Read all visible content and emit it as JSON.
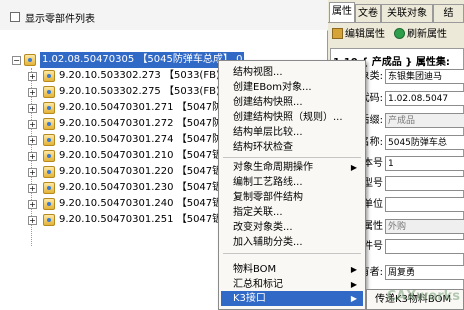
{
  "left_panel": {
    "show_parts_label": "显示零部件列表",
    "tree": [
      {
        "code": "1.02.08.50470305",
        "name": "【5045防弹车总成】",
        "qty": "0",
        "selected": true
      },
      {
        "code": "9.20.10.503302.273",
        "name": "【5033(FB)防"
      },
      {
        "code": "9.20.10.503302.275",
        "name": "【5033(FB)防"
      },
      {
        "code": "9.20.10.50470301.271",
        "name": "【5047防弹"
      },
      {
        "code": "9.20.10.50470301.272",
        "name": "【5047防弹"
      },
      {
        "code": "9.20.10.50470301.274",
        "name": "【5047防弹"
      },
      {
        "code": "9.20.10.50470301.210",
        "name": "【5047钣金"
      },
      {
        "code": "9.20.10.50470301.220",
        "name": "【5047钣金"
      },
      {
        "code": "9.20.10.50470301.230",
        "name": "【5047钣金"
      },
      {
        "code": "9.20.10.50470301.240",
        "name": "【5047钣金"
      },
      {
        "code": "9.20.10.50470301.251",
        "name": "【5047钣金"
      }
    ]
  },
  "context_menu": {
    "items": [
      {
        "label": "结构视图..."
      },
      {
        "label": "创建EBom对象..."
      },
      {
        "label": "创建结构快照..."
      },
      {
        "label": "创建结构快照（规则）..."
      },
      {
        "label": "结构单层比较..."
      },
      {
        "label": "结构环状检查"
      },
      {
        "label": "对象生命周期操作",
        "submenu": true
      },
      {
        "label": "编制工艺路线..."
      },
      {
        "label": "复制零部件结构"
      },
      {
        "label": "指定关联..."
      },
      {
        "label": "改变对象类..."
      },
      {
        "label": "加入辅助分类..."
      },
      {
        "label": "物料BOM",
        "submenu": true
      },
      {
        "label": "汇总和标记",
        "submenu": true
      },
      {
        "label": "K3接口",
        "submenu": true,
        "highlighted": true
      }
    ],
    "submenu_item": "传递K3物料BOM"
  },
  "right_panel": {
    "tabs": [
      "属性",
      "文卷",
      "关联对象",
      "结"
    ],
    "toolbar": {
      "edit": "编辑属性",
      "refresh": "刷新属性"
    },
    "section_title": "1.10 { 产成品 } 属性集:",
    "props": [
      {
        "label": "对象类:",
        "value": "东银集团迪马",
        "gray": false
      },
      {
        "label": "代码:",
        "value": "1.02.08.5047",
        "gray": false
      },
      {
        "label": "代码后缀:",
        "value": "产成品",
        "gray": true
      },
      {
        "label": "名称:",
        "value": "5045防弹车总",
        "gray": false
      },
      {
        "label": "版本号",
        "value": "1",
        "gray": false
      },
      {
        "label": "规格型号",
        "value": "",
        "gray": false
      },
      {
        "label": "计量单位",
        "value": "",
        "gray": false
      },
      {
        "label": "物料属性",
        "value": "外购",
        "gray": true
      },
      {
        "label": "原件号",
        "value": "",
        "gray": false
      },
      {
        "label": "所有者:",
        "value": "周复勇",
        "gray": false
      }
    ]
  },
  "watermark": "CAXworks"
}
